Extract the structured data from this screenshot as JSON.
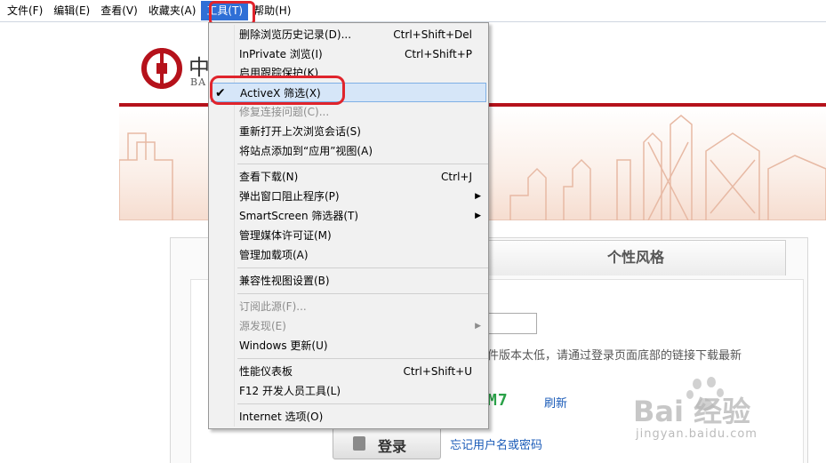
{
  "menubar": {
    "items": [
      "文件(F)",
      "编辑(E)",
      "查看(V)",
      "收藏夹(A)",
      "工具(T)",
      "帮助(H)"
    ]
  },
  "colors": {
    "accent": "#2f6fd6",
    "highlight_border": "#e0242c",
    "bank_red": "#b5121b",
    "link": "#1a5bb8"
  },
  "page": {
    "bank_name_cn": "中",
    "bank_name_en": "BA",
    "tab_label": "个性风格",
    "warning_text": "件版本太低，请通过登录页面底部的链接下载最新",
    "captcha_text": "M7",
    "refresh_label": "刷新",
    "login_label": "登录",
    "forgot_label": "忘记用户名或密码"
  },
  "tools_menu": {
    "items": [
      {
        "label": "删除浏览历史记录(D)...",
        "shortcut": "Ctrl+Shift+Del"
      },
      {
        "label": "InPrivate 浏览(I)",
        "shortcut": "Ctrl+Shift+P"
      },
      {
        "label": "启用跟踪保护(K)",
        "shortcut": ""
      },
      {
        "label": "ActiveX 筛选(X)",
        "shortcut": "",
        "checked": true
      },
      {
        "label": "修复连接问题(C)...",
        "shortcut": "",
        "disabled": true
      },
      {
        "label": "重新打开上次浏览会话(S)",
        "shortcut": ""
      },
      {
        "label": "将站点添加到“应用”视图(A)",
        "shortcut": ""
      },
      {
        "label": "查看下载(N)",
        "shortcut": "Ctrl+J"
      },
      {
        "label": "弹出窗口阻止程序(P)",
        "shortcut": ""
      },
      {
        "label": "SmartScreen 筛选器(T)",
        "shortcut": ""
      },
      {
        "label": "管理媒体许可证(M)",
        "shortcut": ""
      },
      {
        "label": "管理加载项(A)",
        "shortcut": ""
      },
      {
        "label": "兼容性视图设置(B)",
        "shortcut": ""
      },
      {
        "label": "订阅此源(F)...",
        "shortcut": "",
        "disabled": true
      },
      {
        "label": "源发现(E)",
        "shortcut": "",
        "disabled": true
      },
      {
        "label": "Windows 更新(U)",
        "shortcut": ""
      },
      {
        "label": "性能仪表板",
        "shortcut": "Ctrl+Shift+U"
      },
      {
        "label": "F12 开发人员工具(L)",
        "shortcut": ""
      },
      {
        "label": "Internet 选项(O)",
        "shortcut": ""
      }
    ],
    "check_glyph": "✔",
    "submenu_glyph": "▶"
  },
  "watermark": {
    "brand": "Bai 经验",
    "sub": "jingyan.baidu.com"
  }
}
